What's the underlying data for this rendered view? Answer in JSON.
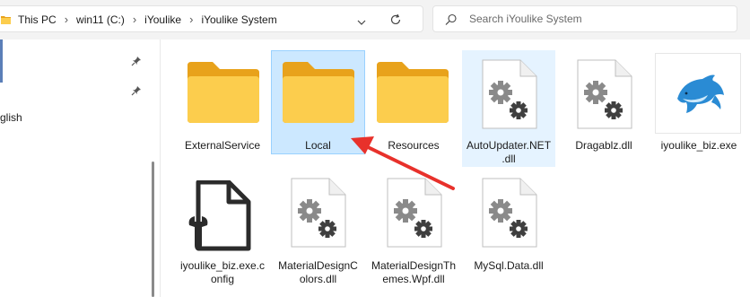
{
  "address": {
    "crumbs": [
      "This PC",
      "win11 (C:)",
      "iYoulike",
      "iYoulike System"
    ],
    "separator": "›"
  },
  "search": {
    "placeholder": "Search iYoulike System"
  },
  "nav": {
    "partial_label": "glish"
  },
  "files": [
    {
      "name": "ExternalService",
      "type": "folder-icon"
    },
    {
      "name": "Local",
      "type": "folder-icon",
      "selected": true
    },
    {
      "name": "Resources",
      "type": "folder-icon"
    },
    {
      "name": "AutoUpdater.NET.dll",
      "display": [
        "AutoUpdater.NET",
        ".dll"
      ],
      "type": "dll-gear-icon",
      "hover": true
    },
    {
      "name": "Dragablz.dll",
      "type": "dll-gear-icon"
    },
    {
      "name": "iyoulike_biz.exe",
      "type": "dolphin-app-icon"
    },
    {
      "name": "iyoulike_biz.exe.config",
      "display": [
        "iyoulike_biz.exe.c",
        "onfig"
      ],
      "type": "config-file-icon"
    },
    {
      "name": "MaterialDesignColors.dll",
      "display": [
        "MaterialDesignC",
        "olors.dll"
      ],
      "type": "dll-gear-icon"
    },
    {
      "name": "MaterialDesignThemes.Wpf.dll",
      "display": [
        "MaterialDesignTh",
        "emes.Wpf.dll"
      ],
      "type": "dll-gear-icon"
    },
    {
      "name": "MySql.Data.dll",
      "type": "dll-gear-icon"
    }
  ],
  "colors": {
    "folder_back": "#e8a21b",
    "folder_front": "#fccd4d",
    "selection": "#cce8ff",
    "arrow": "#e8312b"
  }
}
